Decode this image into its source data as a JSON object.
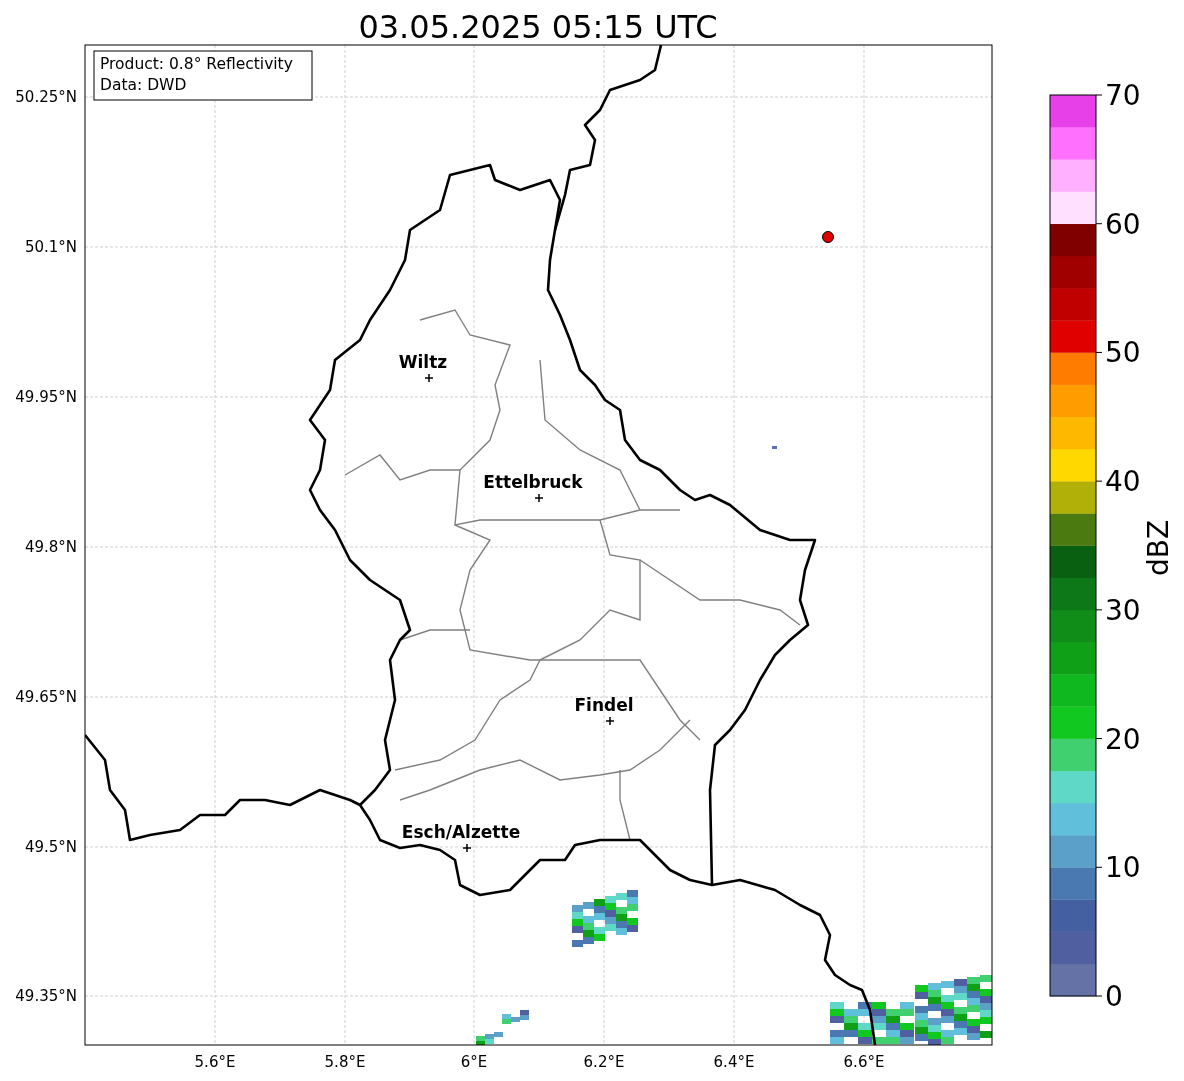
{
  "title": "03.05.2025 05:15 UTC",
  "info_box": {
    "lines": [
      "Product: 0.8° Reflectivity",
      "Data: DWD"
    ]
  },
  "map": {
    "lat_ticks": [
      "50.25°N",
      "50.1°N",
      "49.95°N",
      "49.8°N",
      "49.65°N",
      "49.5°N",
      "49.35°N"
    ],
    "lon_ticks": [
      "5.6°E",
      "5.8°E",
      "6°E",
      "6.2°E",
      "6.4°E",
      "6.6°E"
    ],
    "cities": [
      {
        "name": "Wiltz"
      },
      {
        "name": "Ettelbruck"
      },
      {
        "name": "Findel"
      },
      {
        "name": "Esch/Alzette"
      }
    ]
  },
  "colorbar": {
    "label": "dBZ",
    "ticks": [
      "70",
      "60",
      "50",
      "40",
      "30",
      "20",
      "10",
      "0"
    ],
    "bins": [
      {
        "color": "#6572a5"
      },
      {
        "color": "#505fa0"
      },
      {
        "color": "#4560a0"
      },
      {
        "color": "#4a78b0"
      },
      {
        "color": "#5aa0c8"
      },
      {
        "color": "#60c0dc"
      },
      {
        "color": "#60d8c8"
      },
      {
        "color": "#40d070"
      },
      {
        "color": "#10c820"
      },
      {
        "color": "#10b820"
      },
      {
        "color": "#10a018"
      },
      {
        "color": "#108c18"
      },
      {
        "color": "#0c7818"
      },
      {
        "color": "#086010"
      },
      {
        "color": "#4a7a10"
      },
      {
        "color": "#b0b008"
      },
      {
        "color": "#ffd800"
      },
      {
        "color": "#ffb800"
      },
      {
        "color": "#ff9c00"
      },
      {
        "color": "#ff7c00"
      },
      {
        "color": "#e00000"
      },
      {
        "color": "#c00000"
      },
      {
        "color": "#a00000"
      },
      {
        "color": "#800000"
      },
      {
        "color": "#ffe0ff"
      },
      {
        "color": "#ffb0ff"
      },
      {
        "color": "#ff70ff"
      },
      {
        "color": "#e840e8"
      }
    ]
  }
}
